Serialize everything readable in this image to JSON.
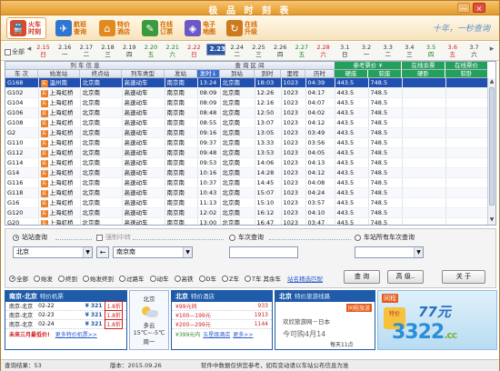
{
  "window": {
    "title": "极 品 时 刻 表",
    "minimize": "—",
    "close": "×"
  },
  "nav": [
    {
      "label": "火车时刻",
      "icon": "train-icon",
      "color": "#d84a2a"
    },
    {
      "label": "航班查询",
      "icon": "plane-icon",
      "color": "#2f76d0"
    },
    {
      "label": "特价酒店",
      "icon": "hotel-icon",
      "color": "#e08a20"
    },
    {
      "label": "在线订票",
      "icon": "ticket-icon",
      "color": "#3b9a3b"
    },
    {
      "label": "电子地图",
      "icon": "map-icon",
      "color": "#6a58c8"
    },
    {
      "label": "在线升级",
      "icon": "upgrade-icon",
      "color": "#cc7a1c"
    }
  ],
  "slogan": "十年，一秒查询",
  "datebar": {
    "all_label": "全部",
    "prev": "◂",
    "next": "▸",
    "dates": [
      {
        "d": "2.15",
        "w": "日",
        "c": "red"
      },
      {
        "d": "2.16",
        "w": "一",
        "c": ""
      },
      {
        "d": "2.17",
        "w": "二",
        "c": ""
      },
      {
        "d": "2.18",
        "w": "三",
        "c": ""
      },
      {
        "d": "2.19",
        "w": "四",
        "c": ""
      },
      {
        "d": "2.20",
        "w": "五",
        "c": "grn"
      },
      {
        "d": "2.21",
        "w": "六",
        "c": "grn"
      },
      {
        "d": "2.22",
        "w": "日",
        "c": "red"
      },
      {
        "d": "2.23",
        "w": "一",
        "c": "sel"
      },
      {
        "d": "2.24",
        "w": "二",
        "c": ""
      },
      {
        "d": "2.25",
        "w": "三",
        "c": ""
      },
      {
        "d": "2.26",
        "w": "四",
        "c": ""
      },
      {
        "d": "2.27",
        "w": "五",
        "c": "grn"
      },
      {
        "d": "2.28",
        "w": "六",
        "c": "red"
      },
      {
        "d": "3.1",
        "w": "日",
        "c": ""
      },
      {
        "d": "3.2",
        "w": "一",
        "c": ""
      },
      {
        "d": "3.3",
        "w": "二",
        "c": ""
      },
      {
        "d": "3.4",
        "w": "三",
        "c": ""
      },
      {
        "d": "3.5",
        "w": "四",
        "c": "grn"
      },
      {
        "d": "3.6",
        "w": "五",
        "c": "red"
      },
      {
        "d": "3.7",
        "w": "六",
        "c": ""
      }
    ]
  },
  "grid": {
    "group_headers": {
      "train": "列 车 信 息",
      "interval": "查 询 区 间",
      "price": "参考票价 ¥",
      "remain": "在线余票",
      "price2": "在线票价"
    },
    "columns": [
      "车 次",
      "始发站",
      "终点站",
      "列车类型",
      "发站",
      "发时↓",
      "到站",
      "到时",
      "里程",
      "历时",
      "硬座",
      "软座",
      "硬卧",
      "软卧"
    ],
    "rows": [
      [
        "G168",
        "温州南",
        "北京南",
        "高速动车",
        "南京南",
        "13:24",
        "北京南",
        "18:03",
        "1023",
        "04:39",
        "443.5",
        "748.5"
      ],
      [
        "G102",
        "上海虹桥",
        "北京南",
        "高速动车",
        "南京南",
        "08:09",
        "北京南",
        "12:26",
        "1023",
        "04:17",
        "443.5",
        "748.5"
      ],
      [
        "G104",
        "上海虹桥",
        "北京南",
        "高速动车",
        "南京南",
        "08:09",
        "北京南",
        "12:16",
        "1023",
        "04:07",
        "443.5",
        "748.5"
      ],
      [
        "G106",
        "上海虹桥",
        "北京南",
        "高速动车",
        "南京南",
        "08:48",
        "北京南",
        "12:50",
        "1023",
        "04:02",
        "443.5",
        "748.5"
      ],
      [
        "G108",
        "上海虹桥",
        "北京南",
        "高速动车",
        "南京南",
        "08:55",
        "北京南",
        "13:07",
        "1023",
        "04:12",
        "443.5",
        "748.5"
      ],
      [
        "G2",
        "上海虹桥",
        "北京南",
        "高速动车",
        "南京南",
        "09:16",
        "北京南",
        "13:05",
        "1023",
        "03:49",
        "443.5",
        "748.5"
      ],
      [
        "G110",
        "上海虹桥",
        "北京南",
        "高速动车",
        "南京南",
        "09:37",
        "北京南",
        "13:33",
        "1023",
        "03:56",
        "443.5",
        "748.5"
      ],
      [
        "G112",
        "上海虹桥",
        "北京南",
        "高速动车",
        "南京南",
        "09:48",
        "北京南",
        "13:53",
        "1023",
        "04:05",
        "443.5",
        "748.5"
      ],
      [
        "G114",
        "上海虹桥",
        "北京南",
        "高速动车",
        "南京南",
        "09:53",
        "北京南",
        "14:06",
        "1023",
        "04:13",
        "443.5",
        "748.5"
      ],
      [
        "G14",
        "上海虹桥",
        "北京南",
        "高速动车",
        "南京南",
        "10:16",
        "北京南",
        "14:28",
        "1023",
        "04:12",
        "443.5",
        "748.5"
      ],
      [
        "G116",
        "上海虹桥",
        "北京南",
        "高速动车",
        "南京南",
        "10:37",
        "北京南",
        "14:45",
        "1023",
        "04:08",
        "443.5",
        "748.5"
      ],
      [
        "G118",
        "上海虹桥",
        "北京南",
        "高速动车",
        "南京南",
        "10:43",
        "北京南",
        "15:07",
        "1023",
        "04:24",
        "443.5",
        "748.5"
      ],
      [
        "G16",
        "上海虹桥",
        "北京南",
        "高速动车",
        "南京南",
        "11:13",
        "北京南",
        "15:10",
        "1023",
        "03:57",
        "443.5",
        "748.5"
      ],
      [
        "G120",
        "上海虹桥",
        "北京南",
        "高速动车",
        "南京南",
        "12:02",
        "北京南",
        "16:12",
        "1023",
        "04:10",
        "443.5",
        "748.5"
      ],
      [
        "G20",
        "上海虹桥",
        "北京南",
        "高速动车",
        "南京南",
        "13:00",
        "北京南",
        "16:47",
        "1023",
        "03:47",
        "443.5",
        "748.5"
      ],
      [
        "G128",
        "上海虹桥",
        "北京南",
        "高速动车",
        "南京南",
        "13:09",
        "北京南",
        "17:39",
        "1023",
        "04:30",
        "443.5",
        "748.5"
      ]
    ],
    "buy_label": "买"
  },
  "query": {
    "station_query": "站站查询",
    "transfer": "强制中转",
    "train_query": "车次查询",
    "all_station_query": "车站所有车次查询",
    "from": "北京",
    "to": "南京南",
    "swap": "←",
    "filters": [
      "全部",
      "始发",
      "终到",
      "始发终到",
      "过路车",
      "动车",
      "高铁",
      "D车",
      "Z车",
      "T车 其余车"
    ],
    "filters_on": [
      true,
      false,
      false,
      false,
      false,
      false,
      false,
      false,
      false,
      false
    ],
    "link": "站名精选匹配",
    "btn_query": "查 询",
    "btn_adv": "高 级..",
    "btn_about": "关 于"
  },
  "ad_flight": {
    "title": "南京-北京",
    "sub": "特价机票",
    "rows": [
      [
        "南京-北京",
        "02-22",
        "¥ 321",
        "1.8折"
      ],
      [
        "南京-北京",
        "02-23",
        "¥ 321",
        "1.8折"
      ],
      [
        "南京-北京",
        "02-24",
        "¥ 321",
        "1.8折"
      ]
    ],
    "foot": "未来三月最低价!",
    "more": "更多特价机票>>"
  },
  "weather": {
    "city": "北京",
    "desc": "多云",
    "temp": "15℃~-5℃",
    "day": "周一"
  },
  "ad_hotel": {
    "title": "北京",
    "sub": "特价酒店",
    "rows": [
      [
        "¥99元间",
        "933"
      ],
      [
        "¥100—199元",
        "1913"
      ],
      [
        "¥200—299元",
        "1144"
      ]
    ],
    "p": "¥399元内",
    "q": "五星级酒店",
    "r": "更多>>"
  },
  "ad_travel": {
    "title": "北京",
    "sub": "特价旅游线路",
    "brand": "同程旅游",
    "line1": "欢欣旅游网－日本",
    "line2": "今可购4月14",
    "line3": "每天11点"
  },
  "banner": {
    "logo": "同程",
    "big": "77元",
    "tag": "特价"
  },
  "watermark": {
    "main": "3322",
    "cc": ".cc"
  },
  "status": {
    "result": "查询结果：53",
    "version": "版本：2015.09.26",
    "note": "软件中数据仅供您参考，如有变动请以车站公布信息为准"
  }
}
